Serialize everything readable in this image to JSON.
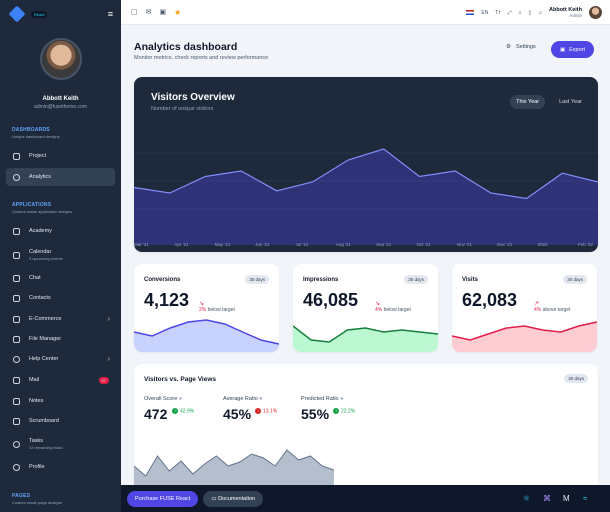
{
  "sidebar": {
    "badge": "React",
    "user": {
      "name": "Abbott Keith",
      "email": "admin@fusetheme.com"
    },
    "sections": [
      {
        "title": "DASHBOARDS",
        "subtitle": "Unique dashboard designs"
      },
      {
        "title": "APPLICATIONS",
        "subtitle": "Custom made application designs"
      },
      {
        "title": "PAGES",
        "subtitle": "Custom made page designs"
      }
    ],
    "items": [
      {
        "label": "Project"
      },
      {
        "label": "Analytics"
      },
      {
        "label": "Academy"
      },
      {
        "label": "Calendar",
        "sub": "3 upcoming events"
      },
      {
        "label": "Chat"
      },
      {
        "label": "Contacts"
      },
      {
        "label": "E-Commerce"
      },
      {
        "label": "File Manager"
      },
      {
        "label": "Help Center"
      },
      {
        "label": "Mail",
        "count": "27"
      },
      {
        "label": "Notes"
      },
      {
        "label": "Scrumboard"
      },
      {
        "label": "Tasks",
        "sub": "12 remaining tasks"
      },
      {
        "label": "Profile"
      }
    ]
  },
  "topbar": {
    "lang": "EN",
    "user_name": "Abbott Keith",
    "user_role": "Admin"
  },
  "header": {
    "title": "Analytics dashboard",
    "subtitle": "Monitor metrics, check reports and review performance",
    "settings": "Settings",
    "export": "Export"
  },
  "visitors": {
    "title": "Visitors Overview",
    "subtitle": "Number of unique visitors",
    "tabs": [
      "This Year",
      "Last Year"
    ],
    "months": [
      "Mar '21",
      "Apr '21",
      "May '21",
      "Jun '21",
      "Jul '21",
      "Aug '21",
      "Sep '21",
      "Oct '21",
      "Nov '21",
      "Dec '21",
      "2022",
      "Feb '22"
    ]
  },
  "stats": [
    {
      "title": "Conversions",
      "badge": "30 days",
      "value": "4,123",
      "pct": "2%",
      "desc": "below target",
      "color": "#4f46e5",
      "fill": "#c7d2fe"
    },
    {
      "title": "Impressions",
      "badge": "30 days",
      "value": "46,085",
      "pct": "4%",
      "desc": "below target",
      "color": "#15803d",
      "fill": "#bbf7d0"
    },
    {
      "title": "Visits",
      "badge": "30 days",
      "value": "62,083",
      "pct": "4%",
      "desc": "above target",
      "color": "#e11d48",
      "fill": "#fecdd3"
    }
  ],
  "vpv": {
    "title": "Visitors vs. Page Views",
    "badge": "30 days",
    "metrics": [
      {
        "label": "Overall Score",
        "value": "472",
        "change": "42.9%",
        "dir": "up"
      },
      {
        "label": "Average Ratio",
        "value": "45%",
        "change": "13.1%",
        "dir": "down"
      },
      {
        "label": "Predicted Ratio",
        "value": "55%",
        "change": "22.2%",
        "dir": "up"
      }
    ]
  },
  "footer": {
    "purchase": "Purchase FUSE React",
    "docs": "Documentation"
  },
  "chart_data": {
    "type": "area",
    "title": "Visitors Overview",
    "x": [
      "Mar '21",
      "Apr '21",
      "May '21",
      "Jun '21",
      "Jul '21",
      "Aug '21",
      "Sep '21",
      "Oct '21",
      "Nov '21",
      "Dec '21",
      "2022",
      "Feb '22"
    ],
    "values": [
      45,
      40,
      55,
      60,
      42,
      50,
      70,
      80,
      55,
      60,
      40,
      35,
      58,
      50
    ]
  }
}
